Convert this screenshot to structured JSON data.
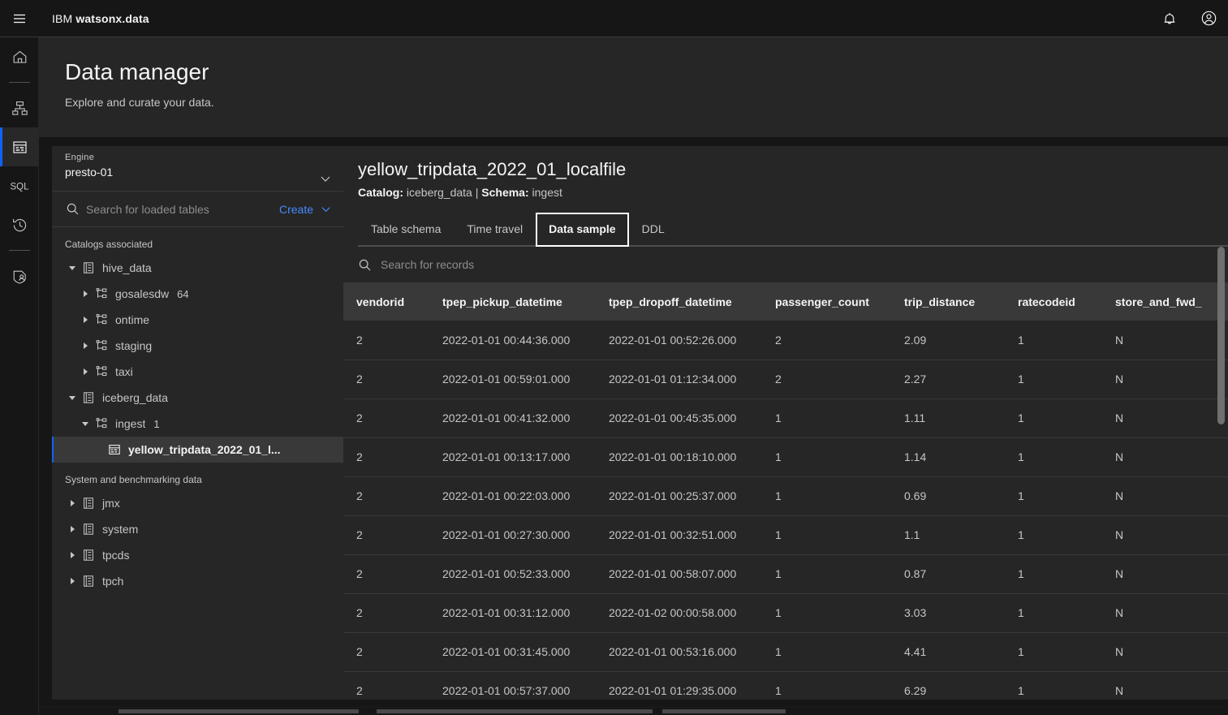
{
  "header": {
    "menu_icon": "hamburger-menu-icon",
    "brand_prefix": "IBM ",
    "brand_name": "watsonx.data",
    "notifications_icon": "bell-icon",
    "account_icon": "user-avatar-icon"
  },
  "rail": {
    "items": [
      {
        "name": "home",
        "icon": "home-icon",
        "active": false
      },
      {
        "name": "infrastructure",
        "icon": "infrastructure-icon",
        "active": false
      },
      {
        "name": "data-manager",
        "icon": "data-manager-icon",
        "active": true
      },
      {
        "name": "sql",
        "icon": "sql-icon",
        "active": false
      },
      {
        "name": "query-history",
        "icon": "history-icon",
        "active": false
      },
      {
        "name": "access-control",
        "icon": "user-access-icon",
        "active": false
      }
    ]
  },
  "page": {
    "title": "Data manager",
    "subtitle": "Explore and curate your data."
  },
  "sidebar": {
    "engine": {
      "label": "Engine",
      "value": "presto-01",
      "chevron": "chevron-down-icon"
    },
    "search": {
      "placeholder": "Search for loaded tables",
      "value": "",
      "icon": "search-icon"
    },
    "create": {
      "label": "Create",
      "chevron": "chevron-down-icon"
    },
    "group_catalogs": "Catalogs associated",
    "group_system": "System and benchmarking data",
    "tree": [
      {
        "label": "hive_data",
        "level": 0,
        "icon": "catalog-icon",
        "caret": "caret-down",
        "count": "",
        "selected": false
      },
      {
        "label": "gosalesdw",
        "level": 1,
        "icon": "schema-icon",
        "caret": "caret-right",
        "count": "64",
        "selected": false
      },
      {
        "label": "ontime",
        "level": 1,
        "icon": "schema-icon",
        "caret": "caret-right",
        "count": "",
        "selected": false
      },
      {
        "label": "staging",
        "level": 1,
        "icon": "schema-icon",
        "caret": "caret-right",
        "count": "",
        "selected": false
      },
      {
        "label": "taxi",
        "level": 1,
        "icon": "schema-icon",
        "caret": "caret-right",
        "count": "",
        "selected": false
      },
      {
        "label": "iceberg_data",
        "level": 0,
        "icon": "catalog-icon",
        "caret": "caret-down",
        "count": "",
        "selected": false
      },
      {
        "label": "ingest",
        "level": 1,
        "icon": "schema-icon",
        "caret": "caret-down",
        "count": "1",
        "selected": false
      },
      {
        "label": "yellow_tripdata_2022_01_l...",
        "level": 2,
        "icon": "table-icon",
        "caret": "",
        "count": "",
        "selected": true
      }
    ],
    "system_tree": [
      {
        "label": "jmx",
        "level": 0,
        "icon": "catalog-icon",
        "caret": "caret-right",
        "count": "",
        "selected": false
      },
      {
        "label": "system",
        "level": 0,
        "icon": "catalog-icon",
        "caret": "caret-right",
        "count": "",
        "selected": false
      },
      {
        "label": "tpcds",
        "level": 0,
        "icon": "catalog-icon",
        "caret": "caret-right",
        "count": "",
        "selected": false
      },
      {
        "label": "tpch",
        "level": 0,
        "icon": "catalog-icon",
        "caret": "caret-right",
        "count": "",
        "selected": false
      }
    ]
  },
  "detail": {
    "title": "yellow_tripdata_2022_01_localfile",
    "catalog_label": "Catalog:",
    "catalog_value": "iceberg_data",
    "separator": "|",
    "schema_label": "Schema:",
    "schema_value": "ingest",
    "tabs": [
      {
        "label": "Table schema",
        "selected": false
      },
      {
        "label": "Time travel",
        "selected": false
      },
      {
        "label": "Data sample",
        "selected": true
      },
      {
        "label": "DDL",
        "selected": false
      }
    ],
    "record_search": {
      "placeholder": "Search for records",
      "value": "",
      "icon": "search-icon"
    }
  },
  "table": {
    "columns": [
      "vendorid",
      "tpep_pickup_datetime",
      "tpep_dropoff_datetime",
      "passenger_count",
      "trip_distance",
      "ratecodeid",
      "store_and_fwd_"
    ],
    "rows": [
      [
        "2",
        "2022-01-01 00:44:36.000",
        "2022-01-01 00:52:26.000",
        "2",
        "2.09",
        "1",
        "N"
      ],
      [
        "2",
        "2022-01-01 00:59:01.000",
        "2022-01-01 01:12:34.000",
        "2",
        "2.27",
        "1",
        "N"
      ],
      [
        "2",
        "2022-01-01 00:41:32.000",
        "2022-01-01 00:45:35.000",
        "1",
        "1.11",
        "1",
        "N"
      ],
      [
        "2",
        "2022-01-01 00:13:17.000",
        "2022-01-01 00:18:10.000",
        "1",
        "1.14",
        "1",
        "N"
      ],
      [
        "2",
        "2022-01-01 00:22:03.000",
        "2022-01-01 00:25:37.000",
        "1",
        "0.69",
        "1",
        "N"
      ],
      [
        "2",
        "2022-01-01 00:27:30.000",
        "2022-01-01 00:32:51.000",
        "1",
        "1.1",
        "1",
        "N"
      ],
      [
        "2",
        "2022-01-01 00:52:33.000",
        "2022-01-01 00:58:07.000",
        "1",
        "0.87",
        "1",
        "N"
      ],
      [
        "2",
        "2022-01-01 00:31:12.000",
        "2022-01-02 00:00:58.000",
        "1",
        "3.03",
        "1",
        "N"
      ],
      [
        "2",
        "2022-01-01 00:31:45.000",
        "2022-01-01 00:53:16.000",
        "1",
        "4.41",
        "1",
        "N"
      ],
      [
        "2",
        "2022-01-01 00:57:37.000",
        "2022-01-01 01:29:35.000",
        "1",
        "6.29",
        "1",
        "N"
      ]
    ]
  },
  "colors": {
    "accent_blue": "#0f62fe",
    "link_blue": "#4589ff",
    "bg_page": "#161616",
    "bg_panel": "#262626",
    "bg_header_row": "#393939",
    "text_primary": "#f4f4f4",
    "text_secondary": "#c6c6c6"
  }
}
